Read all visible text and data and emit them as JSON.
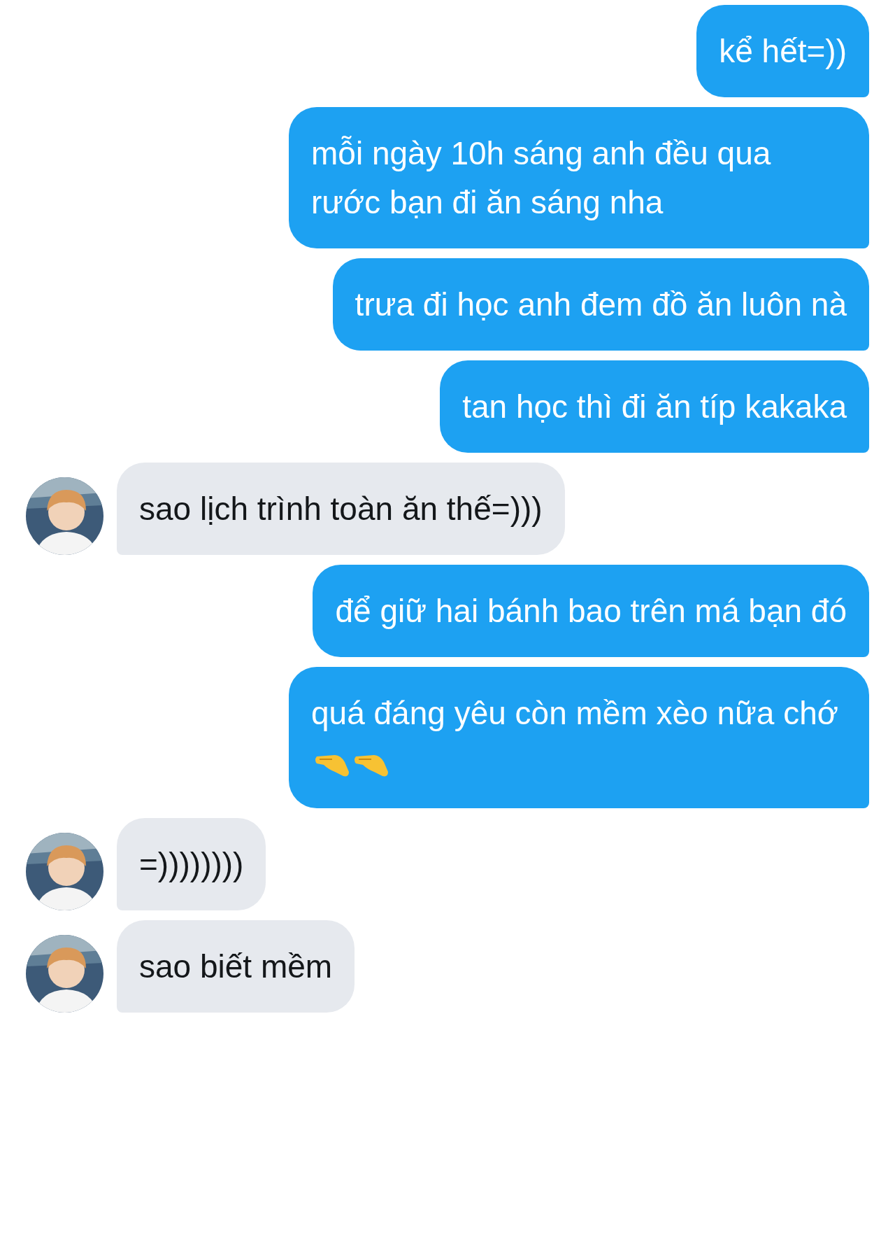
{
  "messages": [
    {
      "kind": "outgoing",
      "text": "kể hết=))"
    },
    {
      "kind": "outgoing",
      "text": "mỗi ngày 10h sáng anh đều qua rước bạn đi ăn sáng nha"
    },
    {
      "kind": "outgoing",
      "text": "trưa đi học anh đem đồ ăn luôn nà"
    },
    {
      "kind": "outgoing",
      "text": "tan học thì đi ăn típ kakaka"
    },
    {
      "kind": "incoming",
      "text": "sao lịch trình toàn ăn thế=)))"
    },
    {
      "kind": "outgoing",
      "text": "để giữ hai bánh bao trên má bạn đó"
    },
    {
      "kind": "outgoing",
      "text": "quá đáng yêu còn mềm xèo nữa chớ",
      "trailing_icons": [
        {
          "kind": "pinching-hand"
        },
        {
          "kind": "pinching-hand"
        }
      ]
    },
    {
      "kind": "incoming",
      "text": "=))))))))"
    },
    {
      "kind": "incoming",
      "text": "sao biết mềm"
    }
  ]
}
